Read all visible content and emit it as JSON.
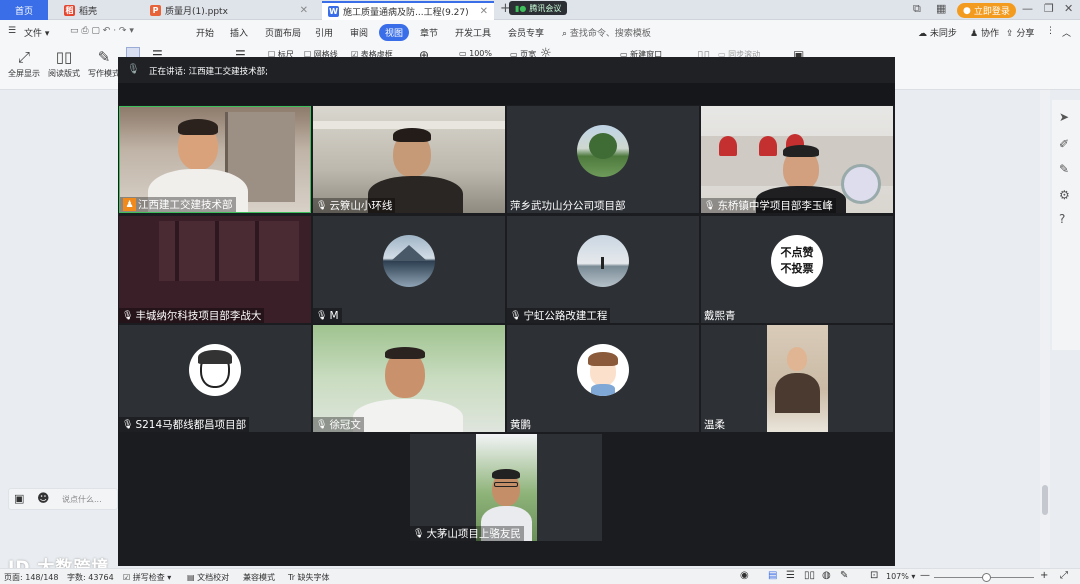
{
  "colors": {
    "accent": "#3a6ee8",
    "talking_border": "#3fbf5b",
    "host_badge": "#f08a1c",
    "login_orange": "#f39b1f"
  },
  "tabs": [
    {
      "label": "首页",
      "icon": "home-tab",
      "kind": "home"
    },
    {
      "label": "稻壳",
      "icon": "docer-icon",
      "kind": "normal"
    },
    {
      "label": "质量月(1).pptx",
      "icon": "ppt-icon",
      "kind": "normal"
    },
    {
      "label": "施工质量通病及防...工程(9.27)",
      "icon": "word-icon",
      "kind": "active"
    }
  ],
  "meeting_tag": "腾讯会议",
  "login_label": "立即登录",
  "menu": {
    "file_label": "文件",
    "items": [
      "开始",
      "插入",
      "页面布局",
      "引用",
      "审阅",
      "视图",
      "章节",
      "开发工具",
      "会员专享"
    ],
    "active": "视图",
    "search_placeholder": "查找命令、搜索模板",
    "sync": "未同步",
    "collab": "协作",
    "share": "分享"
  },
  "ribbon": {
    "fullscreen": "全屏显示",
    "read_mode": "阅读版式",
    "write_mode": "写作模式",
    "ruler": "标尺",
    "gridlines": "网格线",
    "table_borders": "表格虚框",
    "zoom": "100%",
    "page_width": "页宽",
    "new_window": "新建窗口",
    "sync_scroll": "同步滚动"
  },
  "meeting": {
    "speaking_prefix": "正在讲话:",
    "speaking": "江西建工交建技术部;",
    "participants": [
      {
        "name": "江西建工交建技术部",
        "badge": "host",
        "kind": "video-man1",
        "talking": true
      },
      {
        "name": "云簝山小环线",
        "badge": "mic",
        "kind": "video-man2"
      },
      {
        "name": "萍乡武功山分公司项目部",
        "badge": "none",
        "kind": "avatar-tree"
      },
      {
        "name": "东桥镇中学项目部李玉峰",
        "badge": "mic",
        "kind": "video-man3"
      },
      {
        "name": "丰城纳尔科技项目部李战大",
        "badge": "mic",
        "kind": "video-dark"
      },
      {
        "name": "M",
        "badge": "mic",
        "kind": "avatar-mountain"
      },
      {
        "name": "宁虹公路改建工程",
        "badge": "mic",
        "kind": "avatar-sunset"
      },
      {
        "name": "戴熙青",
        "badge": "none",
        "kind": "avatar-text",
        "avatar_text": "不点赞\n不投票"
      },
      {
        "name": "S214马都线都昌项目部",
        "badge": "mic",
        "kind": "avatar-girl"
      },
      {
        "name": "徐冠文",
        "badge": "mic",
        "kind": "video-man4"
      },
      {
        "name": "黄鹏",
        "badge": "none",
        "kind": "avatar-boy"
      },
      {
        "name": "温柔",
        "badge": "none",
        "kind": "video-woman"
      },
      {
        "name": "大茅山项目上骆友民",
        "badge": "mic",
        "kind": "video-man5"
      }
    ]
  },
  "chat_placeholder": "说点什么...",
  "brand": "大数跨境",
  "status": {
    "page": "页面: 148/148",
    "words": "字数: 43764",
    "spell": "拼写检查",
    "proof": "文档校对",
    "compat": "兼容模式",
    "missing_font": "缺失字体",
    "zoom": "107%"
  }
}
